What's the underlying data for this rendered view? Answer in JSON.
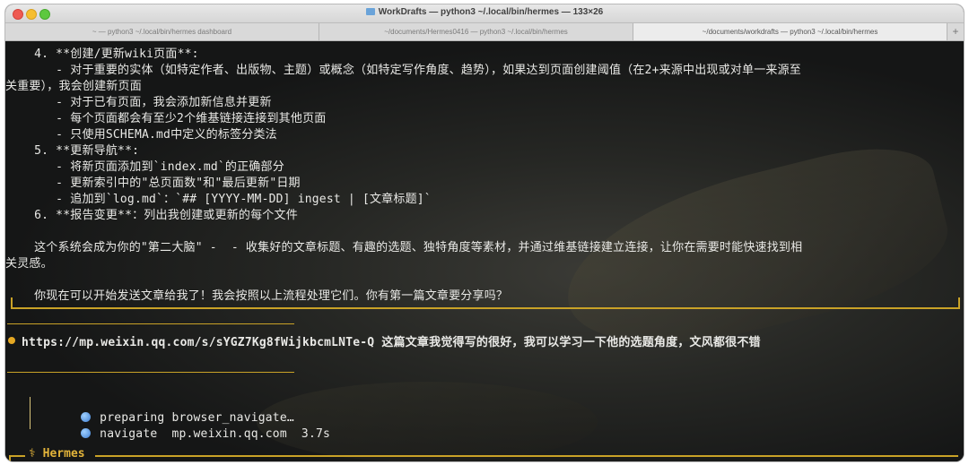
{
  "window": {
    "title": "WorkDrafts — python3 ~/.local/bin/hermes — 133×26"
  },
  "tabs": [
    {
      "label": "~ — python3 ~/.local/bin/hermes dashboard"
    },
    {
      "label": "~/documents/Hermes0416 — python3 ~/.local/bin/hermes"
    },
    {
      "label": "~/documents/workdrafts — python3 ~/.local/bin/hermes"
    },
    {
      "label": "+"
    }
  ],
  "terminal": {
    "lines": [
      "    4. **创建/更新wiki页面**:",
      "       - 对于重要的实体（如特定作者、出版物、主题）或概念（如特定写作角度、趋势），如果达到页面创建阈值（在2+来源中出现或对单一来源至",
      "关重要），我会创建新页面",
      "       - 对于已有页面，我会添加新信息并更新",
      "       - 每个页面都会有至少2个维基链接连接到其他页面",
      "       - 只使用SCHEMA.md中定义的标签分类法",
      "    5. **更新导航**:",
      "       - 将新页面添加到`index.md`的正确部分",
      "       - 更新索引中的\"总页面数\"和\"最后更新\"日期",
      "       - 追加到`log.md`：`## [YYYY-MM-DD] ingest | [文章标题]`",
      "    6. **报告变更**：列出我创建或更新的每个文件",
      "",
      "    这个系统会成为你的\"第二大脑\" -  - 收集好的文章标题、有趣的选题、独特角度等素材，并通过维基链接建立连接，让你在需要时能快速找到相",
      "关灵感。",
      "",
      "    你现在可以开始发送文章给我了！我会按照以上流程处理它们。你有第一篇文章要分享吗？"
    ],
    "user_message": "https://mp.weixin.qq.com/s/sYGZ7Kg8fWijkbcmLNTe-Q 这篇文章我觉得写的很好，我可以学习一下他的选题角度，文风都很不错",
    "tool_lines": [
      {
        "icon": "globe-icon",
        "text": "preparing browser_navigate…"
      },
      {
        "icon": "globe-icon",
        "text": "navigate  mp.weixin.qq.com  3.7s"
      }
    ],
    "footer_label": "⚕ Hermes",
    "colors": {
      "accent": "#c9a227",
      "dot": "#e5a823",
      "text": "#e9e9e6"
    }
  }
}
